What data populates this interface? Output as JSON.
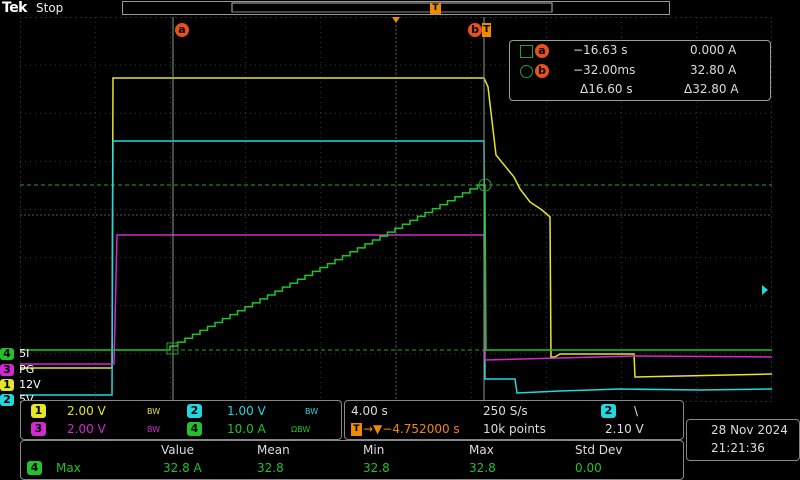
{
  "brand": "Tek",
  "status": "Stop",
  "trigger_marker": "T",
  "cursors": {
    "a_label": "a",
    "b_label": "b",
    "a_time": "−16.63 s",
    "a_value": "0.000 A",
    "b_time": "−32.00ms",
    "b_value": "32.80 A",
    "delta_time": "Δ16.60 s",
    "delta_value": "Δ32.80 A"
  },
  "channels": [
    {
      "num": "4",
      "name": "5I",
      "color": "#22c22a"
    },
    {
      "num": "3",
      "name": "PG",
      "color": "#d02ad0"
    },
    {
      "num": "1",
      "name": "12V",
      "color": "#e5e52a"
    },
    {
      "num": "2",
      "name": "5V",
      "color": "#22d8e0"
    }
  ],
  "settings": {
    "ch1_num": "1",
    "ch1_scale": "2.00 V",
    "ch1_bw": "BW",
    "ch2_num": "2",
    "ch2_scale": "1.00 V",
    "ch2_bw": "BW",
    "ch3_num": "3",
    "ch3_scale": "2.00 V",
    "ch3_bw": "BW",
    "ch4_num": "4",
    "ch4_scale": "10.0 A",
    "ch4_bw": "ΩBW"
  },
  "timebase": {
    "time_div": "4.00 s",
    "sample_rate": "250 S/s",
    "trigger_offset": "→▼−4.752000 s",
    "points": "10k points",
    "trig_source": "2",
    "trig_slope": "\\",
    "trig_level": "2.10 V"
  },
  "datetime": {
    "date": "28 Nov 2024",
    "time": "21:21:36"
  },
  "measurement": {
    "headers": [
      "Value",
      "Mean",
      "Min",
      "Max",
      "Std Dev"
    ],
    "channel": "4",
    "type": "Max",
    "values": [
      "32.8 A",
      "32.8",
      "32.8",
      "32.8",
      "0.00"
    ]
  },
  "colors": {
    "ch1": "#e5e52a",
    "ch2": "#22d8e0",
    "ch3": "#d02ad0",
    "ch4": "#22c22a",
    "cursor": "#e8501e",
    "grid": "#555"
  }
}
